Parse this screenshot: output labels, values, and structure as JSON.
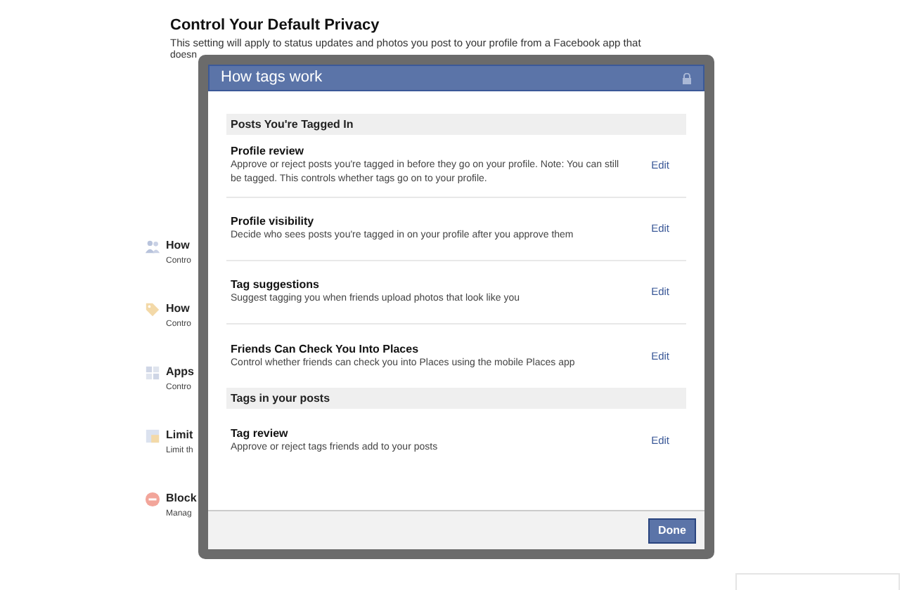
{
  "page": {
    "heading": "Control Your Default Privacy",
    "text": "This setting will apply to status updates and photos you post to your profile from a Facebook app that",
    "text_cut": "doesn",
    "items": [
      {
        "kind": "people",
        "title": "How",
        "desc": "Contro"
      },
      {
        "kind": "tag",
        "title": "How",
        "desc": "Contro"
      },
      {
        "kind": "apps",
        "title": "Apps",
        "desc": "Contro"
      },
      {
        "kind": "limit",
        "title": "Limit",
        "desc": "Limit th"
      },
      {
        "kind": "block",
        "title": "Block",
        "desc": "Manag"
      }
    ]
  },
  "dialog": {
    "title": "How tags work",
    "sections": [
      {
        "heading": "Posts You're Tagged In",
        "rows": [
          {
            "title": "Profile review",
            "desc": "Approve or reject posts you're tagged in before they go on your profile. Note: You can still be tagged. This controls whether tags go on to your profile.",
            "action": "Edit"
          },
          {
            "title": "Profile visibility",
            "desc": "Decide who sees posts you're tagged in on your profile after you approve them",
            "action": "Edit"
          },
          {
            "title": "Tag suggestions",
            "desc": "Suggest tagging you when friends upload photos that look like you",
            "action": "Edit"
          },
          {
            "title": "Friends Can Check You Into Places",
            "desc": "Control whether friends can check you into Places using the mobile Places app",
            "action": "Edit"
          }
        ]
      },
      {
        "heading": "Tags in your posts",
        "rows": [
          {
            "title": "Tag review",
            "desc": "Approve or reject tags friends add to your posts",
            "action": "Edit"
          }
        ]
      }
    ],
    "button": "Done"
  }
}
